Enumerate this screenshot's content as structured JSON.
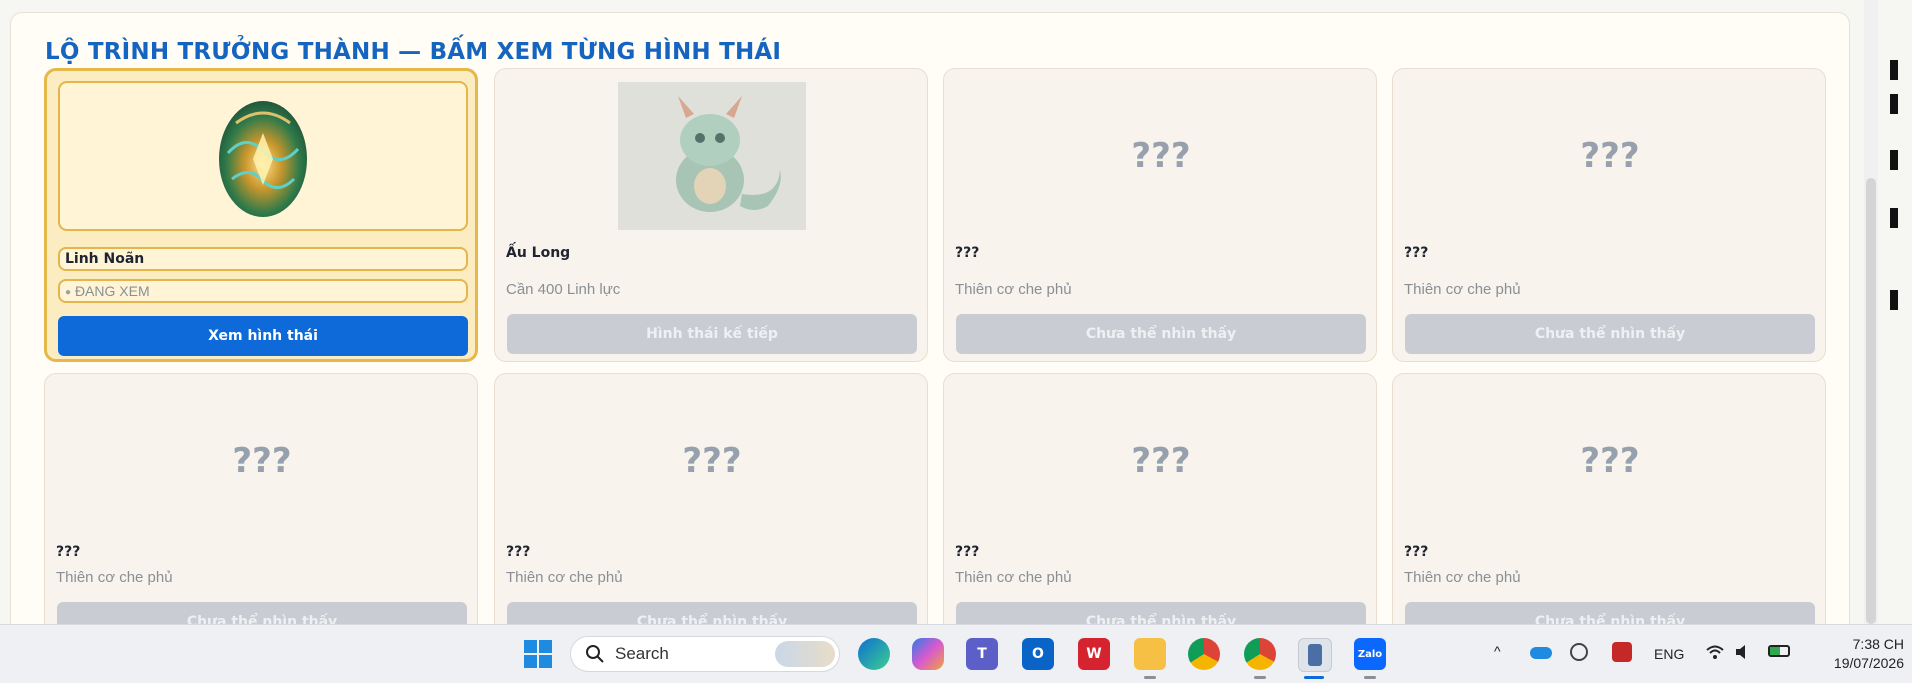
{
  "panel": {
    "title": "LỘ TRÌNH TRƯỞNG THÀNH — BẤM XEM TỪNG HÌNH THÁI"
  },
  "cards": [
    {
      "name": "Linh Noãn",
      "status": "ĐANG XEM",
      "button": "Xem hình thái",
      "image": "dragon-egg",
      "active": true
    },
    {
      "name": "Ấu Long",
      "desc": "Cần 400 Linh lực",
      "button": "Hình thái kế tiếp",
      "image": "baby-dragon"
    },
    {
      "name": "???",
      "desc": "Thiên cơ che phủ",
      "button": "Chưa thể nhìn thấy",
      "placeholder": "???"
    },
    {
      "name": "???",
      "desc": "Thiên cơ che phủ",
      "button": "Chưa thể nhìn thấy",
      "placeholder": "???"
    },
    {
      "name": "???",
      "desc": "Thiên cơ che phủ",
      "button": "Chưa thể nhìn thấy",
      "placeholder": "???"
    },
    {
      "name": "???",
      "desc": "Thiên cơ che phủ",
      "button": "Chưa thể nhìn thấy",
      "placeholder": "???"
    },
    {
      "name": "???",
      "desc": "Thiên cơ che phủ",
      "button": "Chưa thể nhìn thấy",
      "placeholder": "???"
    },
    {
      "name": "???",
      "desc": "Thiên cơ che phủ",
      "button": "Chưa thể nhìn thấy",
      "placeholder": "???"
    }
  ],
  "taskbar": {
    "search_label": "Search",
    "icons": [
      "windows-start-icon",
      "edge-icon",
      "copilot-icon",
      "teams-icon",
      "outlook-icon",
      "wps-icon",
      "file-explorer-icon",
      "chrome-icon",
      "chrome-profile-icon",
      "app-icon",
      "zalo-icon"
    ],
    "zalo_label": "Zalo",
    "wps_label": "W",
    "language": "ENG",
    "time": "7:38 CH",
    "date": "19/07/2026"
  },
  "colors": {
    "accent": "#1565c0",
    "primary_button": "#0d6ad8",
    "active_border": "#e4b84a",
    "disabled_button": "#c9cdd3"
  }
}
